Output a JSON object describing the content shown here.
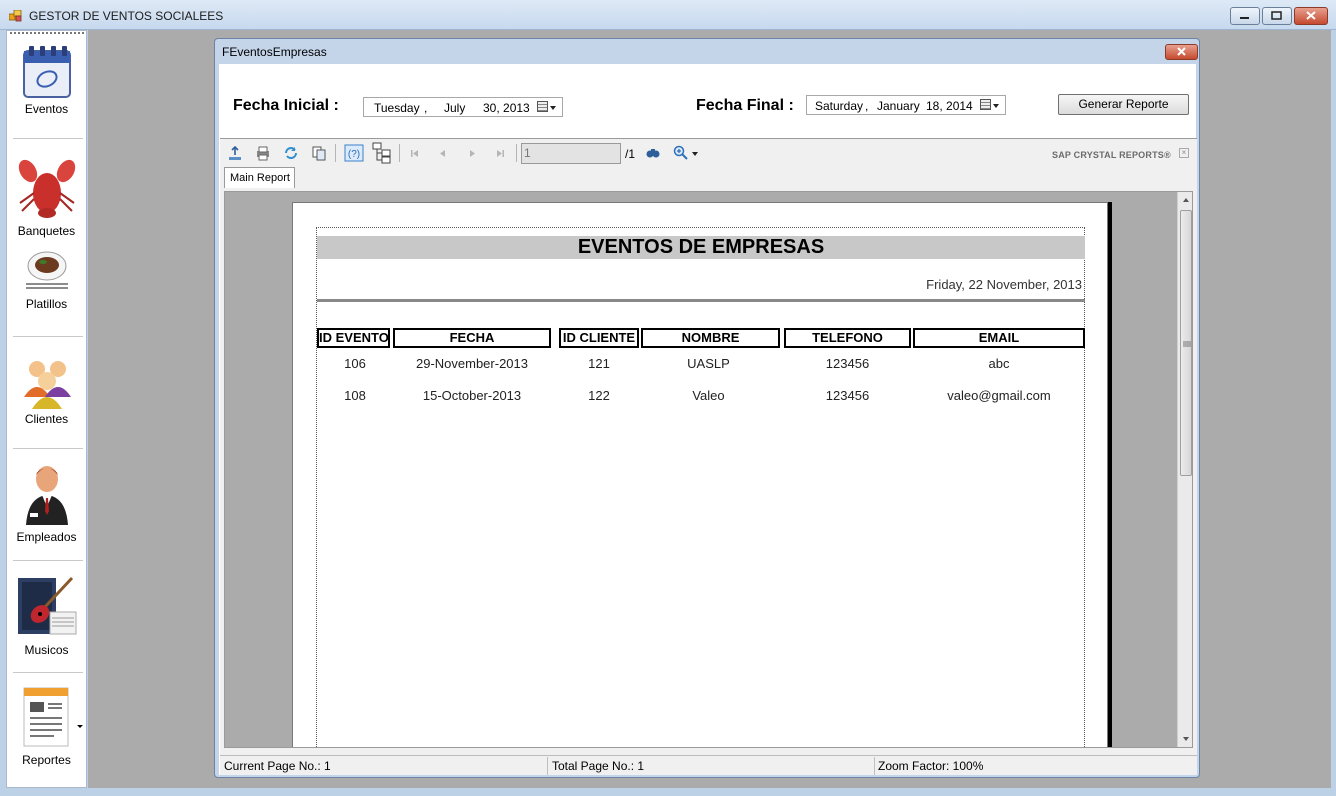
{
  "window": {
    "title": "GESTOR DE VENTOS SOCIALEES"
  },
  "sidebar": {
    "items": [
      {
        "label": "Eventos",
        "icon": "calendar-icon"
      },
      {
        "label": "Banquetes",
        "icon": "lobster-icon"
      },
      {
        "label": "Platillos",
        "icon": "dish-icon"
      },
      {
        "label": "Clientes",
        "icon": "people-icon"
      },
      {
        "label": "Empleados",
        "icon": "businessman-icon"
      },
      {
        "label": "Musicos",
        "icon": "guitar-icon"
      },
      {
        "label": "Reportes",
        "icon": "report-icon"
      }
    ]
  },
  "child": {
    "title": "FEventosEmpresas",
    "fecha_inicial_label": "Fecha Inicial :",
    "fecha_inicial": {
      "day": "Tuesday",
      "sep": ",",
      "month": "July",
      "date": "30, 2013"
    },
    "fecha_final_label": "Fecha Final :",
    "fecha_final": {
      "day": "Saturday",
      "sep": ",",
      "month": "January",
      "date": "18, 2014"
    },
    "generate_button": "Generar Reporte"
  },
  "viewer": {
    "page_input": "1",
    "page_total": "/1",
    "brand": "SAP CRYSTAL REPORTS®",
    "tab": "Main Report",
    "status": {
      "current": "Current Page No.: 1",
      "total": "Total Page No.: 1",
      "zoom": "Zoom Factor: 100%"
    }
  },
  "report": {
    "title": "EVENTOS DE EMPRESAS",
    "date": "Friday, 22 November, 2013",
    "columns": [
      "ID EVENTO",
      "FECHA",
      "ID CLIENTE",
      "NOMBRE",
      "TELEFONO",
      "EMAIL"
    ],
    "rows": [
      [
        "106",
        "29-November-2013",
        "121",
        "UASLP",
        "123456",
        "abc"
      ],
      [
        "108",
        "15-October-2013",
        "122",
        "Valeo",
        "123456",
        "valeo@gmail.com"
      ]
    ]
  }
}
